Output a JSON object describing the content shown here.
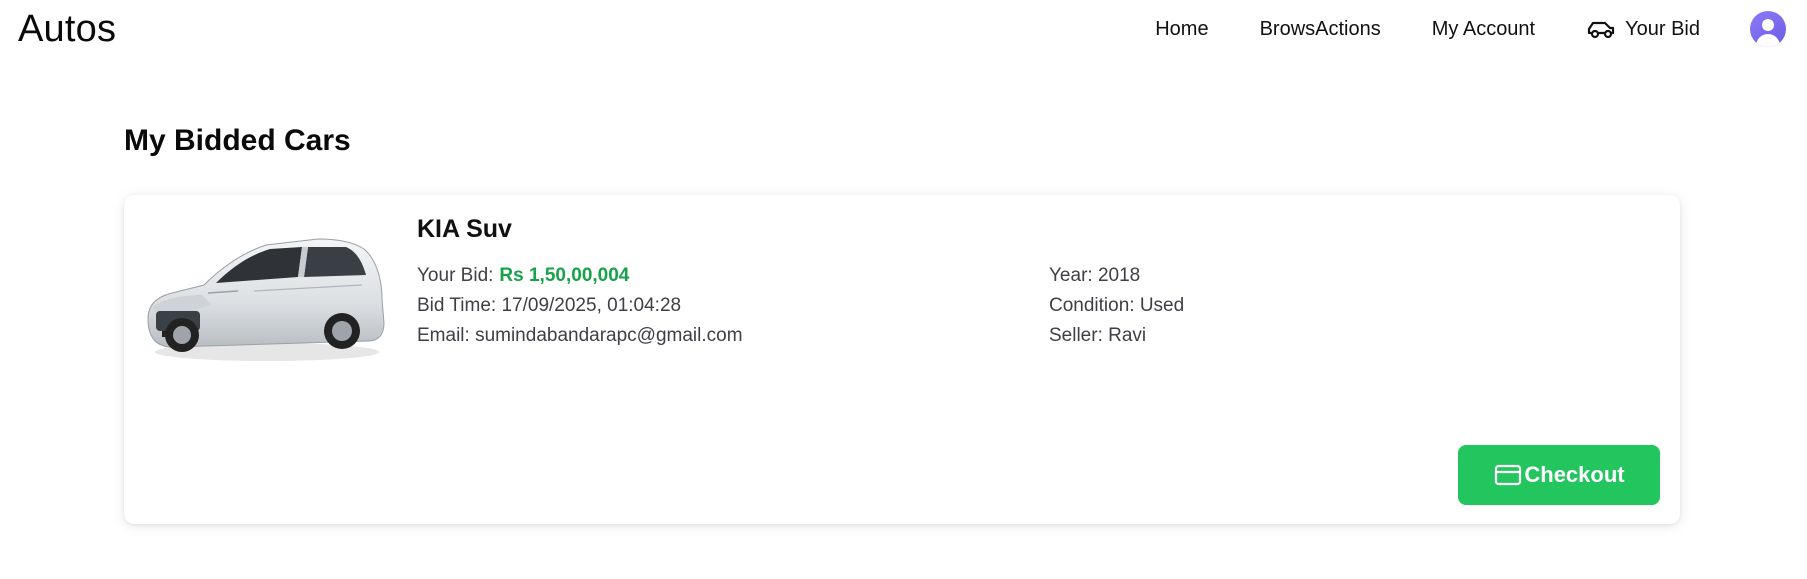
{
  "brand": "Autos",
  "nav": {
    "home": "Home",
    "browse": "BrowsActions",
    "account": "My Account",
    "bid": "Your Bid"
  },
  "page": {
    "title": "My Bidded Cars"
  },
  "bids": [
    {
      "title": "KIA Suv",
      "bid_label": "Your Bid:",
      "bid_amount": "Rs 1,50,00,004",
      "bid_time": "Bid Time: 17/09/2025, 01:04:28",
      "email": "Email: sumindabandarapc@gmail.com",
      "year": "Year: 2018",
      "condition": "Condition: Used",
      "seller": "Seller: Ravi",
      "checkout_label": "Checkout"
    }
  ],
  "colors": {
    "accent_green": "#22c55e",
    "bid_green": "#16a34a",
    "avatar_purple": "#7c6cf0"
  },
  "icons": {
    "bid": "car-icon",
    "checkout": "credit-card-icon",
    "avatar": "user-icon"
  }
}
